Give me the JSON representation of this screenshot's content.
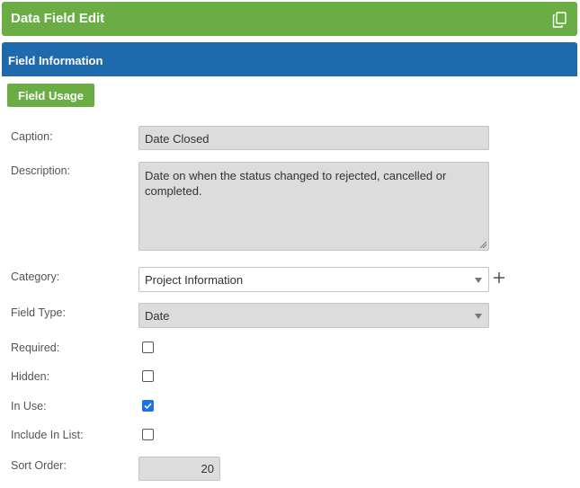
{
  "header": {
    "title": "Data Field Edit",
    "copy_icon": "copy-icon"
  },
  "section": {
    "title": "Field Information"
  },
  "buttons": {
    "field_usage": "Field Usage"
  },
  "form": {
    "caption": {
      "label": "Caption:",
      "value": "Date Closed"
    },
    "description": {
      "label": "Description:",
      "value": "Date on when the status changed to rejected, cancelled or completed."
    },
    "category": {
      "label": "Category:",
      "value": "Project Information",
      "add_icon": "plus-icon"
    },
    "field_type": {
      "label": "Field Type:",
      "value": "Date"
    },
    "required": {
      "label": "Required:",
      "checked": false
    },
    "hidden": {
      "label": "Hidden:",
      "checked": false
    },
    "in_use": {
      "label": "In Use:",
      "checked": true
    },
    "include_in_list": {
      "label": "Include In List:",
      "checked": false
    },
    "sort_order": {
      "label": "Sort Order:",
      "value": "20"
    }
  },
  "colors": {
    "header_green": "#6aad45",
    "section_blue": "#1f6aad",
    "checkbox_blue": "#1a73e8",
    "field_gray": "#dcdcdc"
  }
}
